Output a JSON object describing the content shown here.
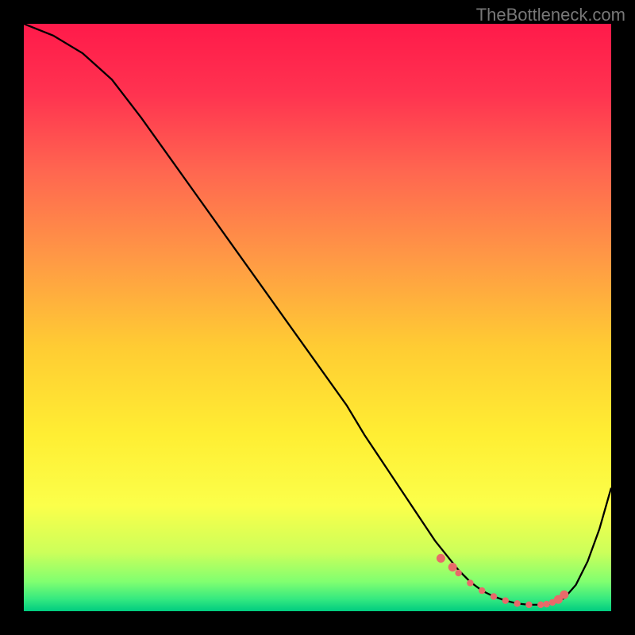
{
  "attribution": "TheBottleneck.com",
  "chart_data": {
    "type": "line",
    "title": "",
    "xlabel": "",
    "ylabel": "",
    "xlim": [
      0,
      100
    ],
    "ylim": [
      0,
      100
    ],
    "series": [
      {
        "name": "bottleneck-curve",
        "x": [
          0,
          5,
          10,
          15,
          20,
          25,
          30,
          35,
          40,
          45,
          50,
          55,
          58,
          60,
          62,
          64,
          66,
          68,
          70,
          72,
          74,
          76,
          78,
          80,
          82,
          84,
          86,
          88,
          90,
          92,
          94,
          96,
          98,
          100
        ],
        "values": [
          100,
          98,
          95,
          90.5,
          84,
          77,
          70,
          63,
          56,
          49,
          42,
          35,
          30,
          27,
          24,
          21,
          18,
          15,
          12,
          9.5,
          7,
          5,
          3.5,
          2.5,
          1.8,
          1.3,
          1.1,
          1.1,
          1.3,
          2.2,
          4.5,
          8.5,
          14,
          21
        ]
      }
    ],
    "markers": {
      "name": "optimal-range",
      "x": [
        71,
        73,
        74,
        76,
        78,
        80,
        82,
        84,
        86,
        88,
        89,
        90,
        91,
        92
      ],
      "values": [
        9,
        7.5,
        6.5,
        4.8,
        3.5,
        2.5,
        1.8,
        1.3,
        1.1,
        1.1,
        1.2,
        1.5,
        2.0,
        2.8
      ]
    },
    "gradient_stops": [
      {
        "offset": 0,
        "color": "#ff1a4a"
      },
      {
        "offset": 12,
        "color": "#ff3350"
      },
      {
        "offset": 25,
        "color": "#ff6650"
      },
      {
        "offset": 40,
        "color": "#ff9945"
      },
      {
        "offset": 55,
        "color": "#ffcc33"
      },
      {
        "offset": 70,
        "color": "#ffee33"
      },
      {
        "offset": 82,
        "color": "#fbff4a"
      },
      {
        "offset": 90,
        "color": "#ccff5a"
      },
      {
        "offset": 95,
        "color": "#80ff70"
      },
      {
        "offset": 98,
        "color": "#33e880"
      },
      {
        "offset": 100,
        "color": "#00cc80"
      }
    ]
  }
}
